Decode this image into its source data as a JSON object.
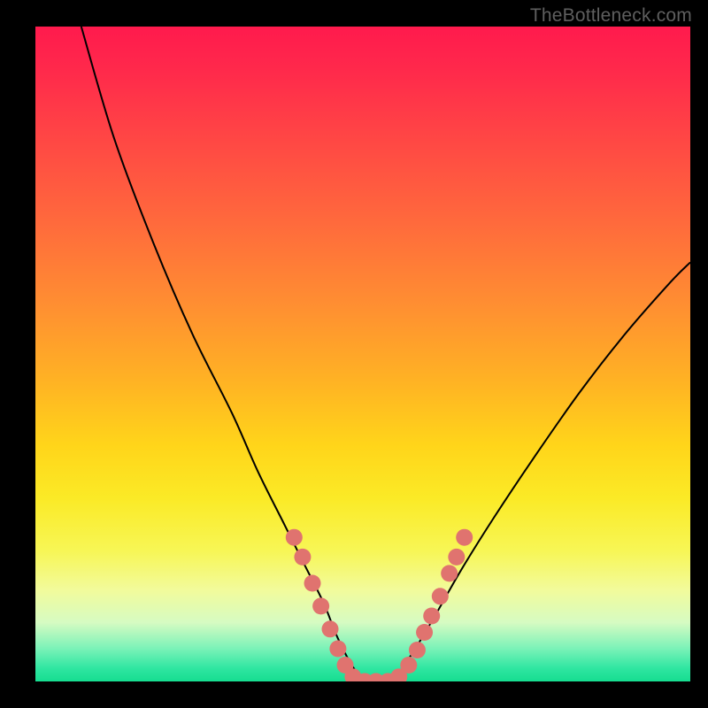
{
  "watermark": "TheBottleneck.com",
  "colors": {
    "frame": "#000000",
    "curve": "#000000",
    "dot": "#e0736f",
    "gradient_top": "#ff1a4d",
    "gradient_mid": "#ffd51a",
    "gradient_bottom": "#16dd90"
  },
  "chart_data": {
    "type": "line",
    "title": "",
    "xlabel": "",
    "ylabel": "",
    "xlim": [
      0,
      100
    ],
    "ylim": [
      0,
      100
    ],
    "note": "Axes are unlabeled; x and y are normalized 0–100 fractions of the plot area. y=0 is the TOP of the gradient (worst), y=100 is the BOTTOM (best/green). The curve depicts a bottleneck V-shape.",
    "series": [
      {
        "name": "left-curve",
        "x": [
          7,
          12,
          18,
          24,
          30,
          34,
          38,
          41,
          44,
          46,
          48,
          50
        ],
        "y": [
          0,
          17,
          33,
          47,
          59,
          68,
          76,
          82,
          88,
          93,
          97,
          100
        ]
      },
      {
        "name": "valley-floor",
        "x": [
          48,
          50,
          52,
          54,
          56
        ],
        "y": [
          99,
          100,
          100,
          100,
          99
        ]
      },
      {
        "name": "right-curve",
        "x": [
          56,
          58,
          61,
          65,
          70,
          76,
          83,
          90,
          97,
          100
        ],
        "y": [
          98,
          95,
          90,
          83,
          75,
          66,
          56,
          47,
          39,
          36
        ]
      }
    ],
    "dots": {
      "name": "highlighted-points",
      "note": "Salmon dots clustered near the valley on both sides and along the floor.",
      "points": [
        {
          "x": 39.5,
          "y": 78
        },
        {
          "x": 40.8,
          "y": 81
        },
        {
          "x": 42.3,
          "y": 85
        },
        {
          "x": 43.6,
          "y": 88.5
        },
        {
          "x": 45.0,
          "y": 92
        },
        {
          "x": 46.2,
          "y": 95
        },
        {
          "x": 47.3,
          "y": 97.5
        },
        {
          "x": 48.5,
          "y": 99.3
        },
        {
          "x": 50.3,
          "y": 100
        },
        {
          "x": 52.0,
          "y": 100
        },
        {
          "x": 53.8,
          "y": 100
        },
        {
          "x": 55.5,
          "y": 99.3
        },
        {
          "x": 57.0,
          "y": 97.5
        },
        {
          "x": 58.3,
          "y": 95.2
        },
        {
          "x": 59.4,
          "y": 92.5
        },
        {
          "x": 60.5,
          "y": 90
        },
        {
          "x": 61.8,
          "y": 87
        },
        {
          "x": 63.2,
          "y": 83.5
        },
        {
          "x": 64.3,
          "y": 81
        },
        {
          "x": 65.5,
          "y": 78
        }
      ]
    }
  }
}
